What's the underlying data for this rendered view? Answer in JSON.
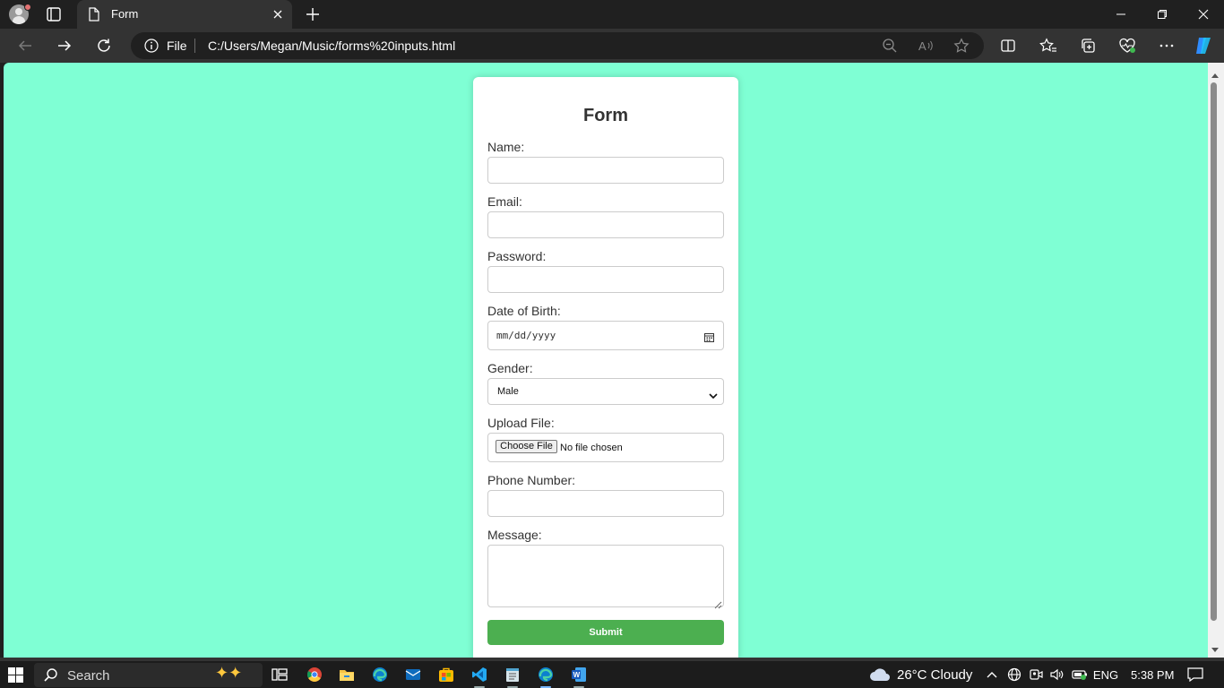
{
  "browser": {
    "tab_title": "Form",
    "address_scheme": "File",
    "address_url": "C:/Users/Megan/Music/forms%20inputs.html"
  },
  "form": {
    "title": "Form",
    "fields": {
      "name_label": "Name:",
      "email_label": "Email:",
      "password_label": "Password:",
      "dob_label": "Date of Birth:",
      "dob_placeholder": "mm/dd/yyyy",
      "gender_label": "Gender:",
      "gender_selected": "Male",
      "upload_label": "Upload File:",
      "upload_button": "Choose File",
      "upload_status": "No file chosen",
      "phone_label": "Phone Number:",
      "message_label": "Message:"
    },
    "submit_label": "Submit",
    "colors": {
      "page_background": "#7fffd4",
      "submit_background": "#4caf50"
    }
  },
  "taskbar": {
    "search_placeholder": "Search",
    "weather": "26°C  Cloudy",
    "language": "ENG",
    "time": "5:38 PM",
    "apps": [
      "task-view",
      "chrome",
      "file-explorer",
      "edge",
      "mail",
      "microsoft-store",
      "vs-code",
      "notepad",
      "edge-active",
      "word"
    ]
  }
}
